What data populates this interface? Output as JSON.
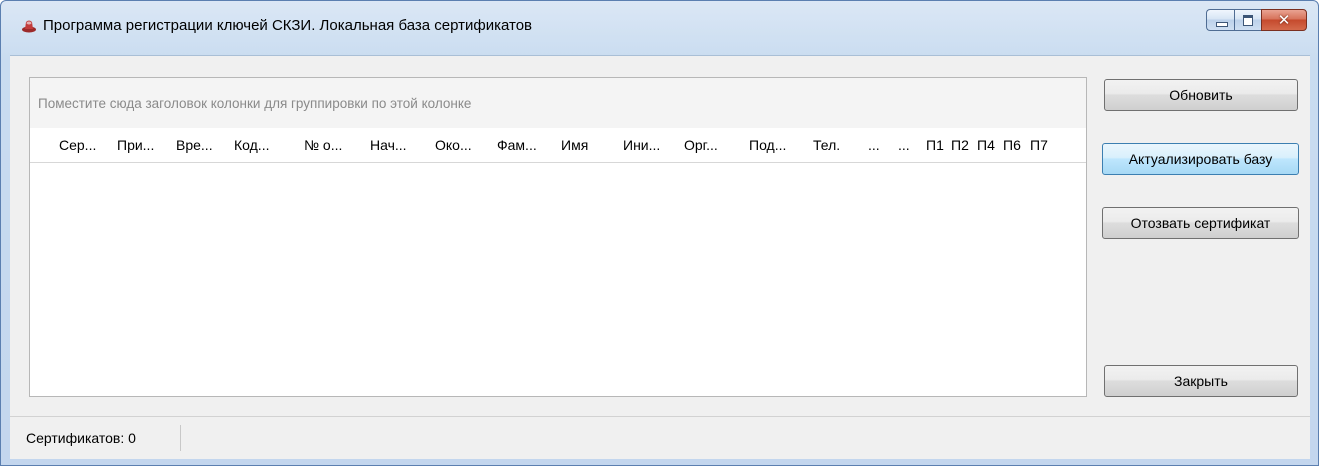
{
  "window": {
    "title": "Программа регистрации ключей СКЗИ. Локальная база сертификатов",
    "icon": "app-icon"
  },
  "grid": {
    "group_hint": "Поместите сюда заголовок колонки для группировки по этой колонке",
    "columns": [
      "Сер...",
      "При...",
      "Вре...",
      "Код...",
      "№ о...",
      "Нач...",
      "Око...",
      "Фам...",
      "Имя",
      "Ини...",
      "Орг...",
      "Под...",
      "Тел.",
      "...",
      "...",
      "П1",
      "П2",
      "П4",
      "П6",
      "П7"
    ]
  },
  "buttons": {
    "refresh": "Обновить",
    "actualize": "Актуализировать базу",
    "revoke": "Отозвать сертификат",
    "close": "Закрыть"
  },
  "status": {
    "certificates": "Сертификатов: 0"
  },
  "colors": {
    "title_gradient_top": "#dbe7f5",
    "close_button": "#c54a2d",
    "focused_button": "#bee6fd"
  }
}
